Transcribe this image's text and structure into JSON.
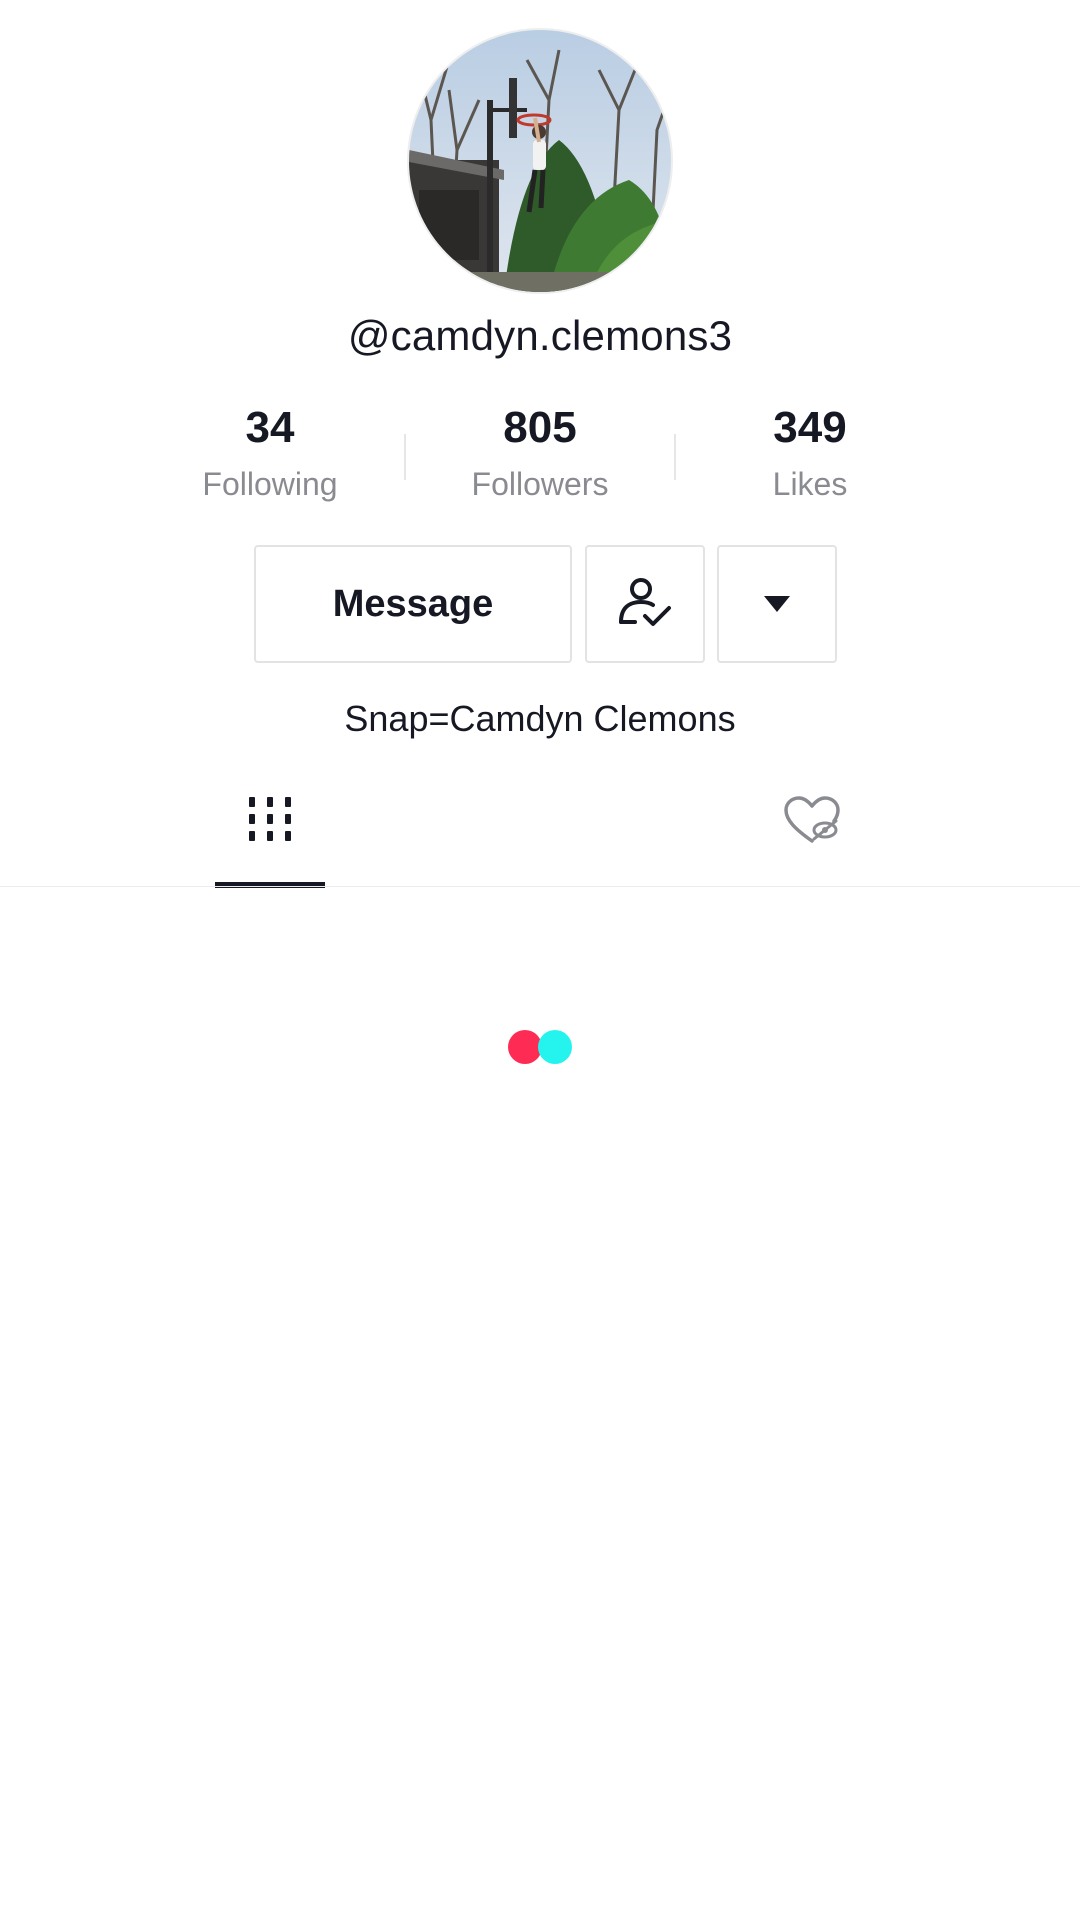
{
  "profile": {
    "username": "@camdyn.clemons3",
    "bio": "Snap=Camdyn Clemons"
  },
  "stats": {
    "following": {
      "value": "34",
      "label": "Following"
    },
    "followers": {
      "value": "805",
      "label": "Followers"
    },
    "likes": {
      "value": "349",
      "label": "Likes"
    }
  },
  "actions": {
    "message_label": "Message",
    "friend_icon": "person-check-icon",
    "more_icon": "caret-down-icon"
  },
  "tabs": [
    {
      "id": "videos",
      "icon": "grid-icon",
      "selected": true
    },
    {
      "id": "liked",
      "icon": "hidden-heart-icon",
      "selected": false
    }
  ],
  "loader": {
    "colors": {
      "primary": "#fe2c55",
      "secondary": "#25f4ee"
    }
  },
  "colors": {
    "text": "#161823",
    "secondary_text": "#8a8b91",
    "border": "#e3e3e4"
  }
}
